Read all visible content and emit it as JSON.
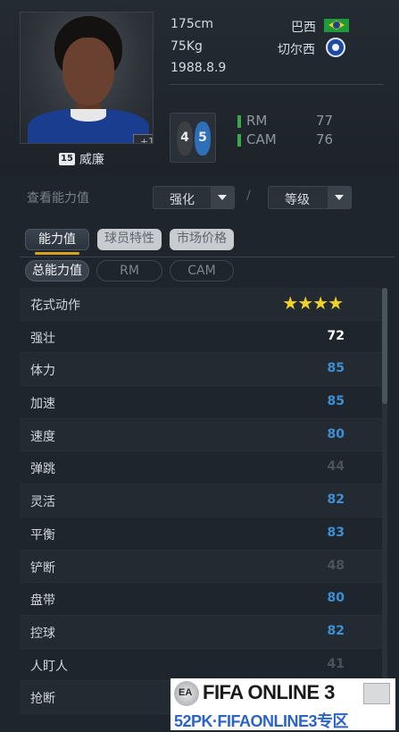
{
  "player": {
    "height": "175cm",
    "weight": "75Kg",
    "birthdate": "1988.8.9",
    "nationality": "巴西",
    "club": "切尔西",
    "name": "威廉",
    "number": "15",
    "plus_badge": "+1",
    "left_foot": "4",
    "right_foot": "5"
  },
  "positions": [
    {
      "label": "RM",
      "value": "77"
    },
    {
      "label": "CAM",
      "value": "76"
    }
  ],
  "view": {
    "label": "查看能力值",
    "enhance_dropdown": "强化",
    "level_dropdown": "等级",
    "separator": "/"
  },
  "tabs": [
    {
      "label": "能力值",
      "active": true
    },
    {
      "label": "球员特性",
      "active": false
    },
    {
      "label": "市场价格",
      "active": false
    }
  ],
  "subtabs": [
    {
      "label": "总能力值",
      "active": true
    },
    {
      "label": "RM",
      "active": false
    },
    {
      "label": "CAM",
      "active": false
    }
  ],
  "attributes": [
    {
      "name": "花式动作",
      "value": "★★★★",
      "type": "stars"
    },
    {
      "name": "强壮",
      "value": "72",
      "color": "#ffffff"
    },
    {
      "name": "体力",
      "value": "85",
      "color": "#3d8fd6"
    },
    {
      "name": "加速",
      "value": "85",
      "color": "#3d8fd6"
    },
    {
      "name": "速度",
      "value": "80",
      "color": "#3d8fd6"
    },
    {
      "name": "弹跳",
      "value": "44",
      "color": "#4a535b"
    },
    {
      "name": "灵活",
      "value": "82",
      "color": "#3d8fd6"
    },
    {
      "name": "平衡",
      "value": "83",
      "color": "#3d8fd6"
    },
    {
      "name": "铲断",
      "value": "48",
      "color": "#4a535b"
    },
    {
      "name": "盘带",
      "value": "80",
      "color": "#3d8fd6"
    },
    {
      "name": "控球",
      "value": "82",
      "color": "#3d8fd6"
    },
    {
      "name": "人盯人",
      "value": "41",
      "color": "#4a535b"
    },
    {
      "name": "抢断",
      "value": "",
      "color": "#4a535b"
    }
  ],
  "watermark": {
    "title": "FIFA ONLINE 3",
    "subtitle": "52PK·FIFAONLINE3专区"
  },
  "colors": {
    "background": "#1f252c",
    "high_value": "#3d8fd6",
    "low_value": "#4a535b",
    "accent_green": "#3ea64b",
    "tab_underline": "#d9a21e"
  }
}
